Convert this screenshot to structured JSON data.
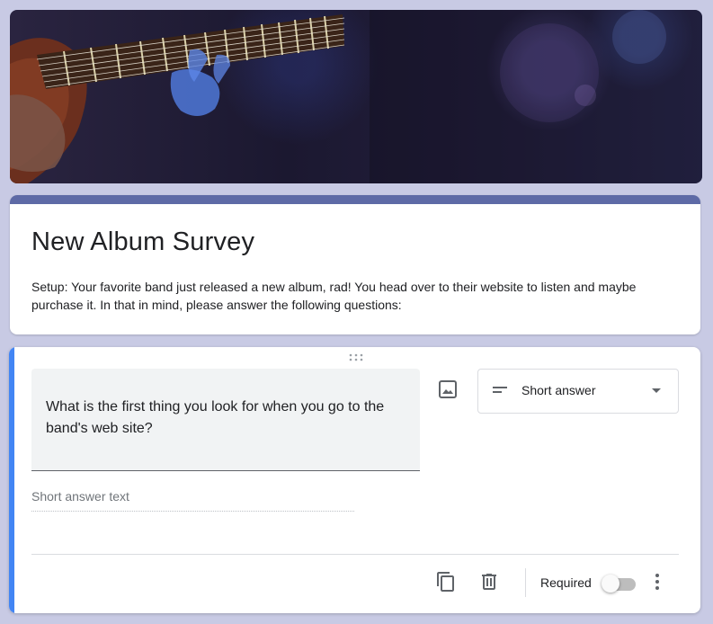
{
  "header": {
    "banner_image": "guitar-player-photo"
  },
  "form": {
    "title": "New Album Survey",
    "description": "Setup: Your favorite band just released a new album, rad! You head over to their website to listen and maybe purchase it. In that in mind, please answer the following questions:"
  },
  "question": {
    "text": "What is the first thing you look for when you go to the band's web site?",
    "type_label": "Short answer",
    "answer_placeholder": "Short answer text",
    "required_label": "Required",
    "required": false
  },
  "icons": {
    "drag": "drag-handle-icon",
    "image": "image-icon",
    "short_answer": "short-answer-icon",
    "dropdown": "dropdown-arrow-icon",
    "duplicate": "copy-icon",
    "delete": "trash-icon",
    "more": "more-vert-icon"
  },
  "colors": {
    "page_background": "#c8cae4",
    "theme_accent": "#5e6aa6",
    "active_question_accent": "#4285f4"
  }
}
